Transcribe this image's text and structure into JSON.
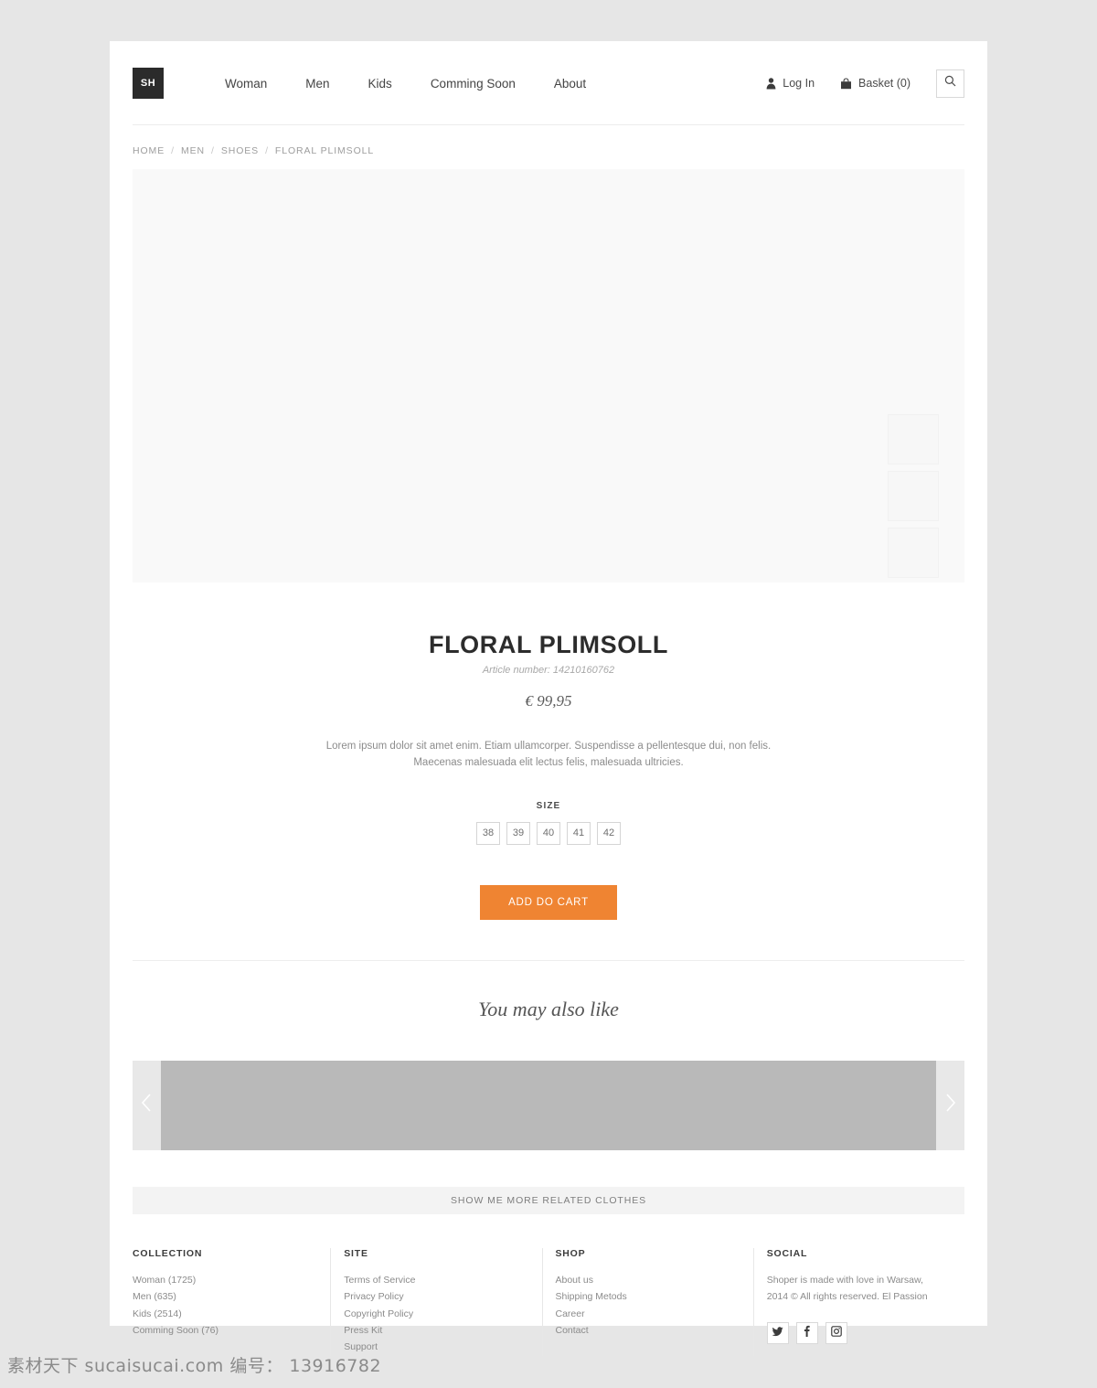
{
  "header": {
    "logo": "SH",
    "nav": [
      {
        "label": "Woman"
      },
      {
        "label": "Men"
      },
      {
        "label": "Kids"
      },
      {
        "label": "Comming Soon"
      },
      {
        "label": "About"
      }
    ],
    "login_label": "Log In",
    "basket_label": "Basket (0)",
    "search_icon": "search-icon"
  },
  "breadcrumb": {
    "items": [
      "HOME",
      "MEN",
      "SHOES",
      "FLORAL PLIMSOLL"
    ],
    "separator": "/"
  },
  "product": {
    "title": "FLORAL PLIMSOLL",
    "article": "Article number: 14210160762",
    "price": "€ 99,95",
    "description": "Lorem ipsum dolor sit amet enim. Etiam ullamcorper. Suspendisse a pellentesque dui, non felis. Maecenas malesuada elit lectus felis, malesuada ultricies.",
    "size_label": "SIZE",
    "sizes": [
      "38",
      "39",
      "40",
      "41",
      "42"
    ],
    "cta_label": "ADD DO CART",
    "cta_color": "#ef8432"
  },
  "related": {
    "heading": "You may also like",
    "prev_icon": "chevron-left-icon",
    "next_icon": "chevron-right-icon",
    "show_more_label": "SHOW ME MORE RELATED CLOTHES"
  },
  "footer": {
    "columns": [
      {
        "title": "COLLECTION",
        "links": [
          "Woman (1725)",
          "Men (635)",
          "Kids (2514)",
          "Comming Soon (76)"
        ]
      },
      {
        "title": "SITE",
        "links": [
          "Terms of Service",
          "Privacy Policy",
          "Copyright Policy",
          "Press Kit",
          "Support"
        ]
      },
      {
        "title": "SHOP",
        "links": [
          "About us",
          "Shipping Metods",
          "Career",
          "Contact"
        ]
      }
    ],
    "social": {
      "title": "SOCIAL",
      "line1": "Shoper is made with love in Warsaw,",
      "line2": "2014 © All rights reserved. El Passion",
      "icons": [
        "twitter-icon",
        "facebook-icon",
        "instagram-icon"
      ]
    }
  },
  "watermark": "素材天下 sucaisucai.com  编号： 13916782"
}
